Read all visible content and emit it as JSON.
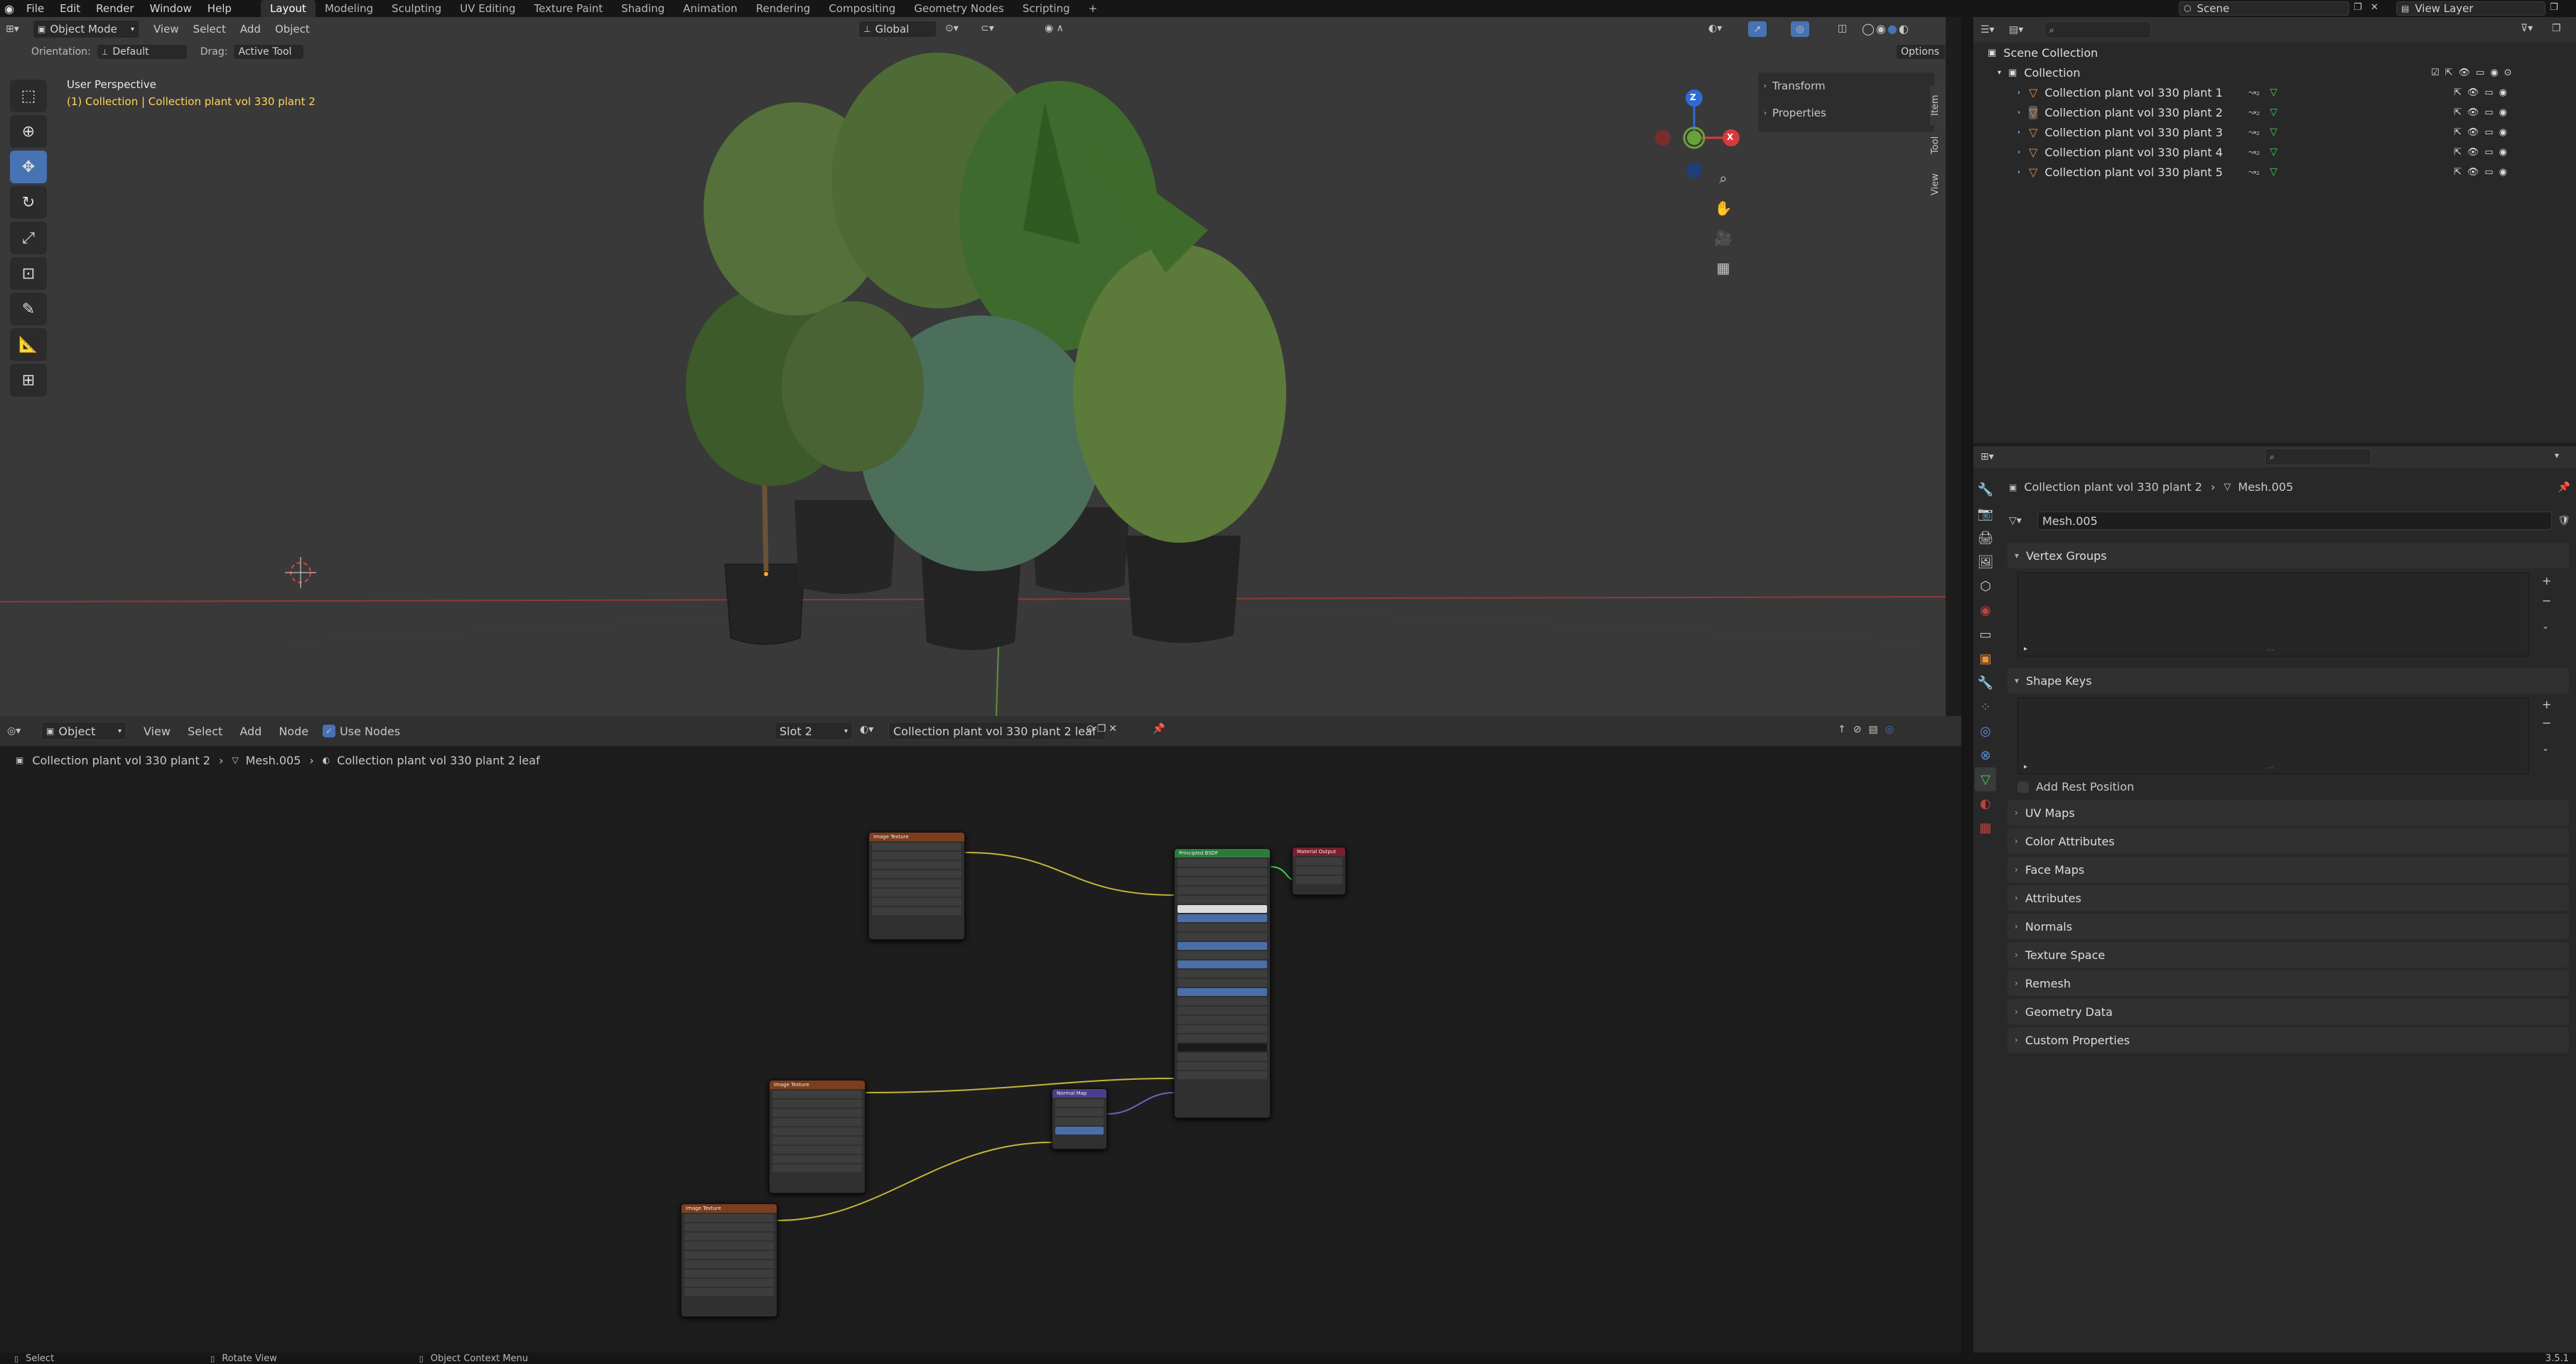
{
  "topbar": {
    "menus": [
      "File",
      "Edit",
      "Render",
      "Window",
      "Help"
    ],
    "workspaces": [
      "Layout",
      "Modeling",
      "Sculpting",
      "UV Editing",
      "Texture Paint",
      "Shading",
      "Animation",
      "Rendering",
      "Compositing",
      "Geometry Nodes",
      "Scripting"
    ],
    "active_workspace": "Layout",
    "add_workspace": "+",
    "scene_label": "Scene",
    "view_layer_label": "View Layer"
  },
  "viewport": {
    "mode": "Object Mode",
    "menus": [
      "View",
      "Select",
      "Add",
      "Object"
    ],
    "transform_orientation": "Global",
    "orientation_label": "Orientation:",
    "orientation_value": "Default",
    "drag_label": "Drag:",
    "drag_value": "Active Tool",
    "options_label": "Options",
    "overlay_title": "User Perspective",
    "overlay_subtitle": "(1) Collection | Collection plant vol 330 plant 2",
    "sidebar_panels": [
      "Transform",
      "Properties"
    ],
    "sidebar_tabs": [
      "Item",
      "Tool",
      "View"
    ],
    "gizmo": {
      "z": "Z",
      "x": "X",
      "y": "Y"
    }
  },
  "node_editor": {
    "editor_type": "Object",
    "menus": [
      "View",
      "Select",
      "Add",
      "Node"
    ],
    "use_nodes_label": "Use Nodes",
    "slot": "Slot 2",
    "material": "Collection plant vol 330 plant 2 leaf",
    "breadcrumb": [
      "Collection plant vol 330 plant 2",
      "Mesh.005",
      "Collection plant vol 330 plant 2 leaf"
    ],
    "nodes": {
      "tex1_title": "Image Texture",
      "tex2_title": "Image Texture",
      "tex3_title": "Image Texture",
      "bsdf_title": "Principled BSDF",
      "output_title": "Material Output",
      "normal_title": "Normal Map"
    }
  },
  "outliner": {
    "root": "Scene Collection",
    "collection": "Collection",
    "items": [
      "Collection plant vol 330 plant 1",
      "Collection plant vol 330 plant 2",
      "Collection plant vol 330 plant 3",
      "Collection plant vol 330 plant 4",
      "Collection plant vol 330 plant 5"
    ]
  },
  "properties": {
    "object_name": "Collection plant vol 330 plant 2",
    "mesh_name": "Mesh.005",
    "data_name_field": "Mesh.005",
    "panels_open": [
      "Vertex Groups",
      "Shape Keys"
    ],
    "add_rest_position": "Add Rest Position",
    "panels_closed": [
      "UV Maps",
      "Color Attributes",
      "Face Maps",
      "Attributes",
      "Normals",
      "Texture Space",
      "Remesh",
      "Geometry Data",
      "Custom Properties"
    ]
  },
  "status": {
    "select": "Select",
    "rotate": "Rotate View",
    "context": "Object Context Menu",
    "version": "3.5.1"
  }
}
